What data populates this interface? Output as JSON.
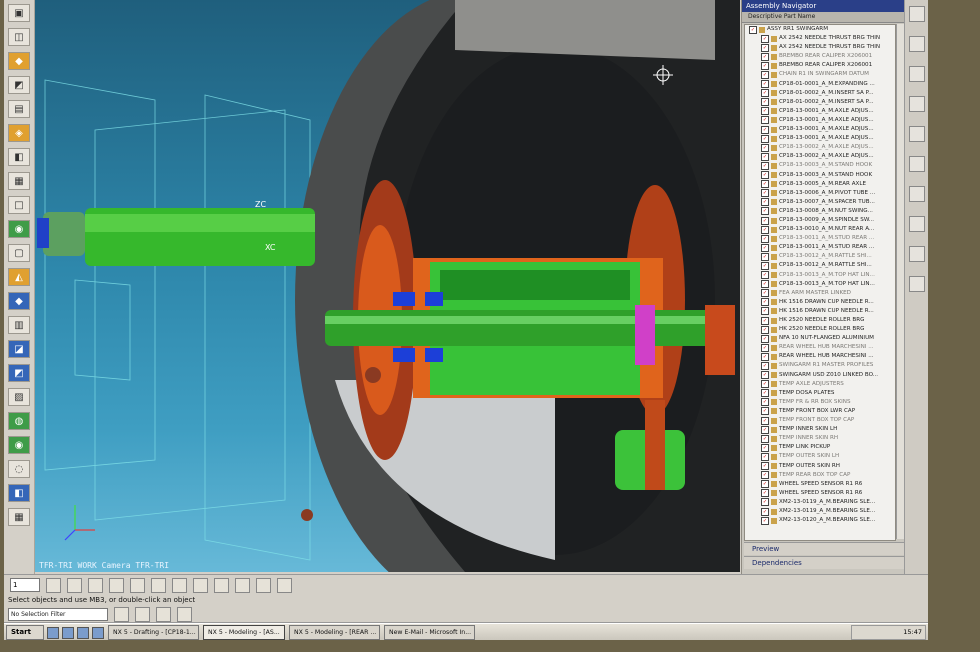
{
  "viewport": {
    "camera_label": "TFR-TRI WORK Camera TFR-TRI",
    "axis_zc": "ZC",
    "axis_xc": "XC"
  },
  "navigator": {
    "title": "Assembly Navigator",
    "column_header": "Descriptive Part Name",
    "rows": [
      "ASSY RR1 SWINGARM",
      "AX 2542 NEEDLE THRUST BRG THIN",
      "AX 2542 NEEDLE THRUST BRG THIN",
      "BREMBO REAR CALIPER X206001",
      "BREMBO REAR CALIPER X206001",
      "CHAIN R1 IN SWINGARM DATUM",
      "CP18-01-0001_A_M.EXPANDING ...",
      "CP18-01-0002_A_M.INSERT SA P...",
      "CP18-01-0002_A_M.INSERT SA P...",
      "CP18-13-0001_A_M.AXLE ADJUS...",
      "CP18-13-0001_A_M.AXLE ADJUS...",
      "CP18-13-0001_A_M.AXLE ADJUS...",
      "CP18-13-0001_A_M.AXLE ADJUS...",
      "CP18-13-0002_A_M.AXLE ADJUS...",
      "CP18-13-0002_A_M.AXLE ADJUS...",
      "CP18-13-0003_A_M.STAND HOOK",
      "CP18-13-0003_A_M.STAND HOOK",
      "CP18-13-0005_A_M.REAR AXLE",
      "CP18-13-0006_A_M.PIVOT TUBE ...",
      "CP18-13-0007_A_M.SPACER TUB...",
      "CP18-13-0008_A_M.NUT SWING...",
      "CP18-13-0009_A_M.SPINDLE SW...",
      "CP18-13-0010_A_M.NUT REAR A...",
      "CP18-13-0011_A_M.STUD REAR ...",
      "CP18-13-0011_A_M.STUD REAR ...",
      "CP18-13-0012_A_M.RATTLE SHI...",
      "CP18-13-0012_A_M.RATTLE SHI...",
      "CP18-13-0013_A_M.TOP HAT LIN...",
      "CP18-13-0013_A_M.TOP HAT LIN...",
      "FEA ARM MASTER LINKED",
      "HK 1516 DRAWN CUP NEEDLE R...",
      "HK 1516 DRAWN CUP NEEDLE R...",
      "HK 2520 NEEDLE ROLLER BRG",
      "HK 2520 NEEDLE ROLLER BRG",
      "NFA 10 NUT-FLANGED ALUMINIUM",
      "REAR WHEEL HUB MARCHESINI ...",
      "REAR WHEEL HUB MARCHESINI ...",
      "SWINGARM R1 MASTER PROFILES",
      "SWINGARM USD Z010 LINKED BO...",
      "TEMP AXLE ADJUSTERS",
      "TEMP DOSA PLATES",
      "TEMP FR & RR BOX SKINS",
      "TEMP FRONT BOX LWR CAP",
      "TEMP FRONT BOX TOP CAP",
      "TEMP INNER SKIN LH",
      "TEMP INNER SKIN RH",
      "TEMP LINK PICKUP",
      "TEMP OUTER SKIN LH",
      "TEMP OUTER SKIN RH",
      "TEMP REAR BOX TOP CAP",
      "WHEEL SPEED SENSOR R1 R6",
      "WHEEL SPEED SENSOR R1 R6",
      "XM2-13-0119_A_M.BEARING SLE...",
      "XM2-13-0119_A_M.BEARING SLE...",
      "XM2-13-0120_A_M.BEARING SLE..."
    ],
    "preview_label": "Preview",
    "dependencies_label": "Dependencies"
  },
  "toolbar": {
    "layer_value": "1"
  },
  "status": {
    "prompt": "Select objects and use MB3, or double-click an object",
    "filter": "No Selection Filter"
  },
  "taskbar": {
    "start": "Start",
    "tasks": [
      "NX 5 - Drafting - [CP18-1...",
      "NX 5 - Modeling - [AS...",
      "NX 5 - Modeling - [REAR ...",
      "New E-Mail - Microsoft In..."
    ],
    "clock": "15:47"
  },
  "colors": {
    "viewport_top": "#1f5f7d",
    "viewport_bottom": "#67b9d8",
    "model_green": "#3fbf3a",
    "model_orange": "#e0641c",
    "model_red": "#9c3018",
    "model_blue": "#1c3fd8",
    "nav_title": "#2a3f88"
  }
}
